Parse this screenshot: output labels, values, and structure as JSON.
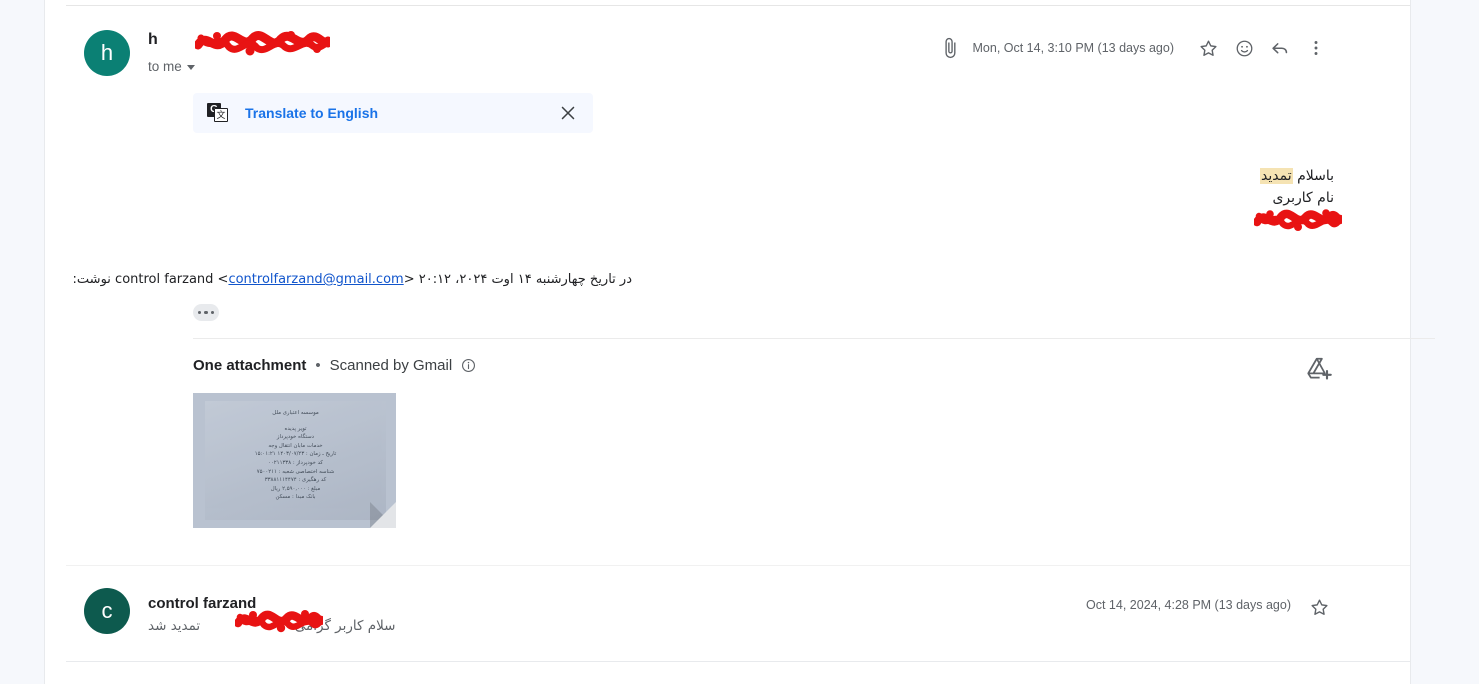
{
  "app": "gmail-conversation-thread",
  "message_top": {
    "avatar_letter": "h",
    "avatar_color": "#0b8074",
    "sender_name_visible": "h",
    "sender_name_redacted": true,
    "recipient_label": "to me",
    "attachment_indicator_icon": "paperclip-icon",
    "date": "Mon, Oct 14, 3:10 PM (13 days ago)",
    "actions": [
      {
        "icon": "star-icon",
        "label": "Star"
      },
      {
        "icon": "emoji-icon",
        "label": "Add emoji reaction"
      },
      {
        "icon": "reply-icon",
        "label": "Reply"
      },
      {
        "icon": "more-vert-icon",
        "label": "More"
      }
    ],
    "translate_banner": {
      "icon": "google-translate-icon",
      "icon_letters": {
        "back": "G",
        "front": "文"
      },
      "label": "Translate to English",
      "close_icon": "close-icon"
    },
    "body_lines": [
      {
        "plain": "باسلام ",
        "highlight": "تمدید",
        "highlight_color": "#f5e3b3"
      },
      {
        "plain": "نام کاربری"
      },
      {
        "plain": "",
        "redacted": true
      }
    ],
    "quoted_line": {
      "prefix_rtl": "در تاریخ چهارشنبه ۱۴ اوت ۲۰۲۴، ۲۰:۱۲",
      "sender": "control farzand",
      "email": "controlfarzand@gmail.com",
      "suffix_rtl": "نوشت:"
    },
    "trimmed_content_button": "show-trimmed-content"
  },
  "attachments": {
    "count_label": "One attachment",
    "separator": "•",
    "scan_label": "Scanned by Gmail",
    "info_icon": "info-icon",
    "add_to_drive_icon": "add-to-drive-icon",
    "thumbnail": {
      "type": "image-receipt",
      "lines": [
        "موسسه اعتباری ملل",
        "تویر پدیده",
        "دستگاه خودپرداز",
        "خدمات مابان انتقال وجه",
        "تاریخ ـ زمان : ۱۴۰۳/۰۷/۲۳  ۱۵:۰۱:۲۱",
        "کد خودپرداز : ۰۰۲۱۱۳۳۸",
        "شناسه اختصاصی شعبه : ۷۵۰۰۲۱۱",
        "کد رهگیری : ۳۳۸۸۱۱۱۴۴۷۴",
        "مبلغ : ۲,۵۹۰,۰۰۰ ریال",
        "بانک مبدا : مسکن"
      ]
    }
  },
  "message_bottom": {
    "avatar_letter": "c",
    "avatar_color": "#0d5a4e",
    "sender_name": "control farzand",
    "snippet_before": "سلام کاربر گرامی",
    "snippet_after": "تمدید شد",
    "snippet_redacted": true,
    "date": "Oct 14, 2024, 4:28 PM (13 days ago)",
    "star_icon": "star-icon"
  },
  "colors": {
    "page_background": "#f6f8fc",
    "panel_background": "#ffffff",
    "link_blue": "#1a73e8",
    "quoted_link_blue": "#1155cc",
    "secondary_text": "#5f6368",
    "primary_text": "#202124",
    "redaction": "#e81313",
    "highlight": "#f5e3b3"
  }
}
